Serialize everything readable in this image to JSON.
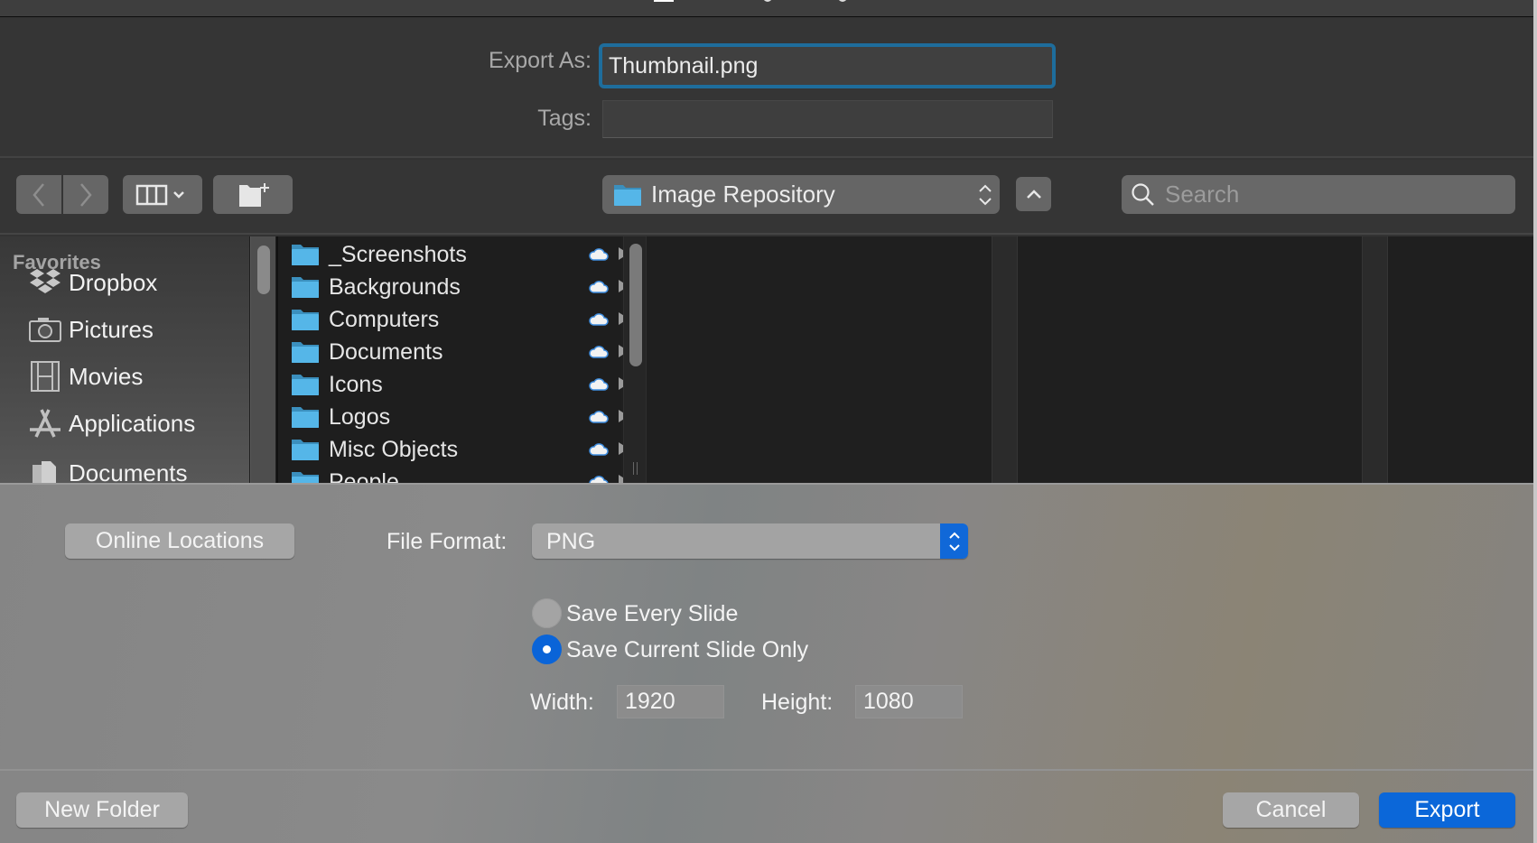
{
  "dialog": {
    "export_as_label": "Export As:",
    "export_as_value": "Thumbnail.png",
    "tags_label": "Tags:",
    "tags_value": ""
  },
  "toolbar": {
    "back_icon": "chevron-left-icon",
    "forward_icon": "chevron-right-icon",
    "view_icon": "column-view-icon",
    "new_folder_icon": "new-folder-icon",
    "location": "Image Repository",
    "search_placeholder": "Search"
  },
  "sidebar": {
    "section": "Favorites",
    "items": [
      {
        "label": "Dropbox",
        "icon": "dropbox-icon"
      },
      {
        "label": "Pictures",
        "icon": "camera-icon"
      },
      {
        "label": "Movies",
        "icon": "film-icon"
      },
      {
        "label": "Applications",
        "icon": "applications-icon"
      },
      {
        "label": "Documents",
        "icon": "documents-icon"
      }
    ]
  },
  "files": [
    {
      "name": "_Screenshots"
    },
    {
      "name": "Backgrounds"
    },
    {
      "name": "Computers"
    },
    {
      "name": "Documents"
    },
    {
      "name": "Icons"
    },
    {
      "name": "Logos"
    },
    {
      "name": "Misc Objects"
    },
    {
      "name": "People"
    }
  ],
  "options": {
    "online_locations": "Online Locations",
    "file_format_label": "File Format:",
    "file_format_value": "PNG",
    "radio_every": "Save Every Slide",
    "radio_current": "Save Current Slide Only",
    "radio_selected": "current",
    "width_label": "Width:",
    "width_value": "1920",
    "height_label": "Height:",
    "height_value": "1080"
  },
  "footer": {
    "new_folder": "New Folder",
    "cancel": "Cancel",
    "export": "Export"
  },
  "colors": {
    "accent": "#0b67d9",
    "focus_ring": "#1e6d9c",
    "folder": "#4fb3e8"
  }
}
